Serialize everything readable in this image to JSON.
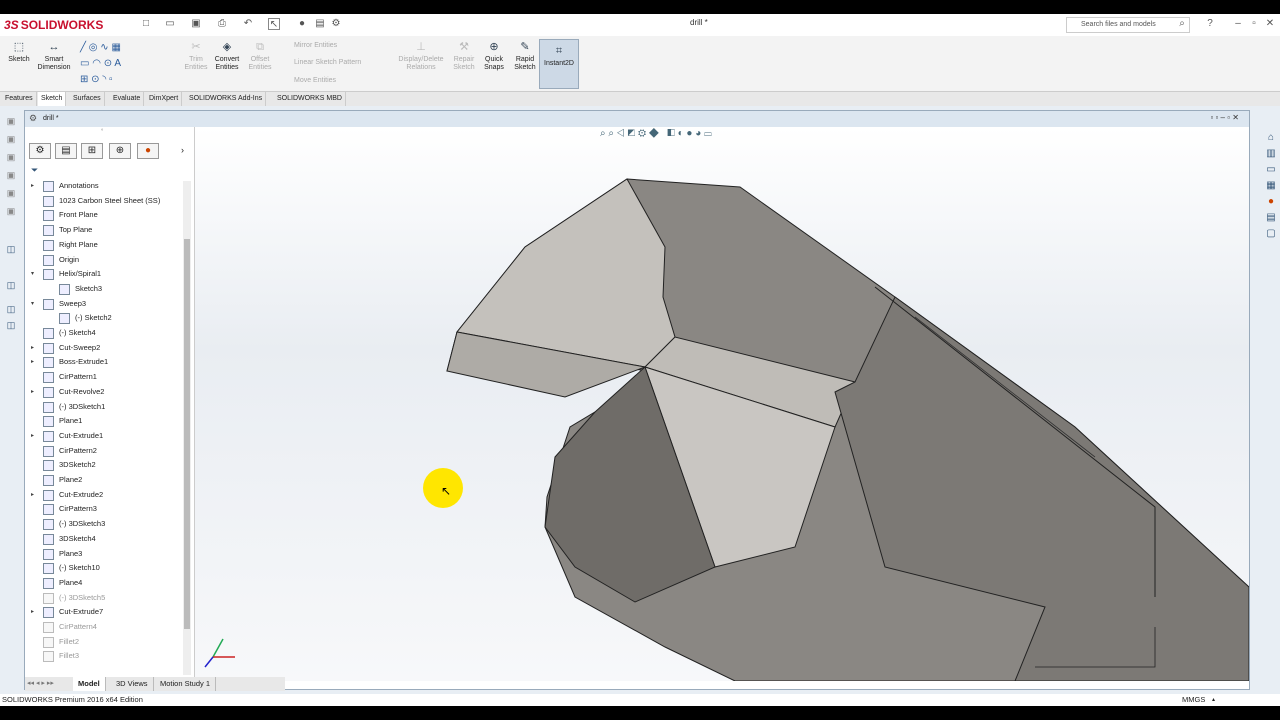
{
  "app": {
    "brand_ds": "3S",
    "brand": "SOLIDWORKS",
    "doc_title": "drill *",
    "search_placeholder": "Search files and models"
  },
  "ribbon": {
    "sketch": "Sketch",
    "smart_dimension": "Smart Dimension",
    "trim_entities": "Trim Entities",
    "convert_entities": "Convert Entities",
    "offset_entities": "Offset Entities",
    "mirror_entities": "Mirror Entities",
    "linear_sketch_pattern": "Linear Sketch Pattern",
    "move_entities": "Move Entities",
    "display_delete_relations": "Display/Delete Relations",
    "repair_sketch": "Repair Sketch",
    "quick_snaps": "Quick Snaps",
    "rapid_sketch": "Rapid Sketch",
    "instant2d": "Instant2D"
  },
  "tabs": [
    "Features",
    "Sketch",
    "Surfaces",
    "Evaluate",
    "DimXpert",
    "SOLIDWORKS Add-Ins",
    "SOLIDWORKS MBD"
  ],
  "doc": {
    "title": "drill *"
  },
  "tree": [
    {
      "label": "Annotations",
      "exp": "▸",
      "dim": false
    },
    {
      "label": "1023 Carbon Steel Sheet (SS)",
      "exp": "",
      "dim": false
    },
    {
      "label": "Front Plane",
      "exp": "",
      "dim": false
    },
    {
      "label": "Top Plane",
      "exp": "",
      "dim": false
    },
    {
      "label": "Right Plane",
      "exp": "",
      "dim": false
    },
    {
      "label": "Origin",
      "exp": "",
      "dim": false
    },
    {
      "label": "Helix/Spiral1",
      "exp": "▾",
      "dim": false
    },
    {
      "label": "Sketch3",
      "exp": "",
      "dim": false,
      "indent": true
    },
    {
      "label": "Sweep3",
      "exp": "▾",
      "dim": false
    },
    {
      "label": "(-) Sketch2",
      "exp": "",
      "dim": false,
      "indent": true
    },
    {
      "label": "(-) Sketch4",
      "exp": "",
      "dim": false
    },
    {
      "label": "Cut-Sweep2",
      "exp": "▸",
      "dim": false
    },
    {
      "label": "Boss-Extrude1",
      "exp": "▸",
      "dim": false
    },
    {
      "label": "CirPattern1",
      "exp": "",
      "dim": false
    },
    {
      "label": "Cut-Revolve2",
      "exp": "▸",
      "dim": false
    },
    {
      "label": "(-) 3DSketch1",
      "exp": "",
      "dim": false
    },
    {
      "label": "Plane1",
      "exp": "",
      "dim": false
    },
    {
      "label": "Cut-Extrude1",
      "exp": "▸",
      "dim": false
    },
    {
      "label": "CirPattern2",
      "exp": "",
      "dim": false
    },
    {
      "label": "3DSketch2",
      "exp": "",
      "dim": false
    },
    {
      "label": "Plane2",
      "exp": "",
      "dim": false
    },
    {
      "label": "Cut-Extrude2",
      "exp": "▸",
      "dim": false
    },
    {
      "label": "CirPattern3",
      "exp": "",
      "dim": false
    },
    {
      "label": "(-) 3DSketch3",
      "exp": "",
      "dim": false
    },
    {
      "label": "3DSketch4",
      "exp": "",
      "dim": false
    },
    {
      "label": "Plane3",
      "exp": "",
      "dim": false
    },
    {
      "label": "(-) Sketch10",
      "exp": "",
      "dim": false
    },
    {
      "label": "Plane4",
      "exp": "",
      "dim": false
    },
    {
      "label": "(-) 3DSketch5",
      "exp": "",
      "dim": true
    },
    {
      "label": "Cut-Extrude7",
      "exp": "▸",
      "dim": false
    },
    {
      "label": "CirPattern4",
      "exp": "",
      "dim": true
    },
    {
      "label": "Fillet2",
      "exp": "",
      "dim": true
    },
    {
      "label": "Fillet3",
      "exp": "",
      "dim": true
    }
  ],
  "bottom_tabs": [
    "Model",
    "3D Views",
    "Motion Study 1"
  ],
  "status": {
    "edition": "SOLIDWORKS Premium 2016 x64 Edition",
    "units": "MMGS"
  },
  "colors": {
    "accent": "#c8102e",
    "part_face_light": "#c9c6c2",
    "part_face_dark": "#7a7772"
  }
}
